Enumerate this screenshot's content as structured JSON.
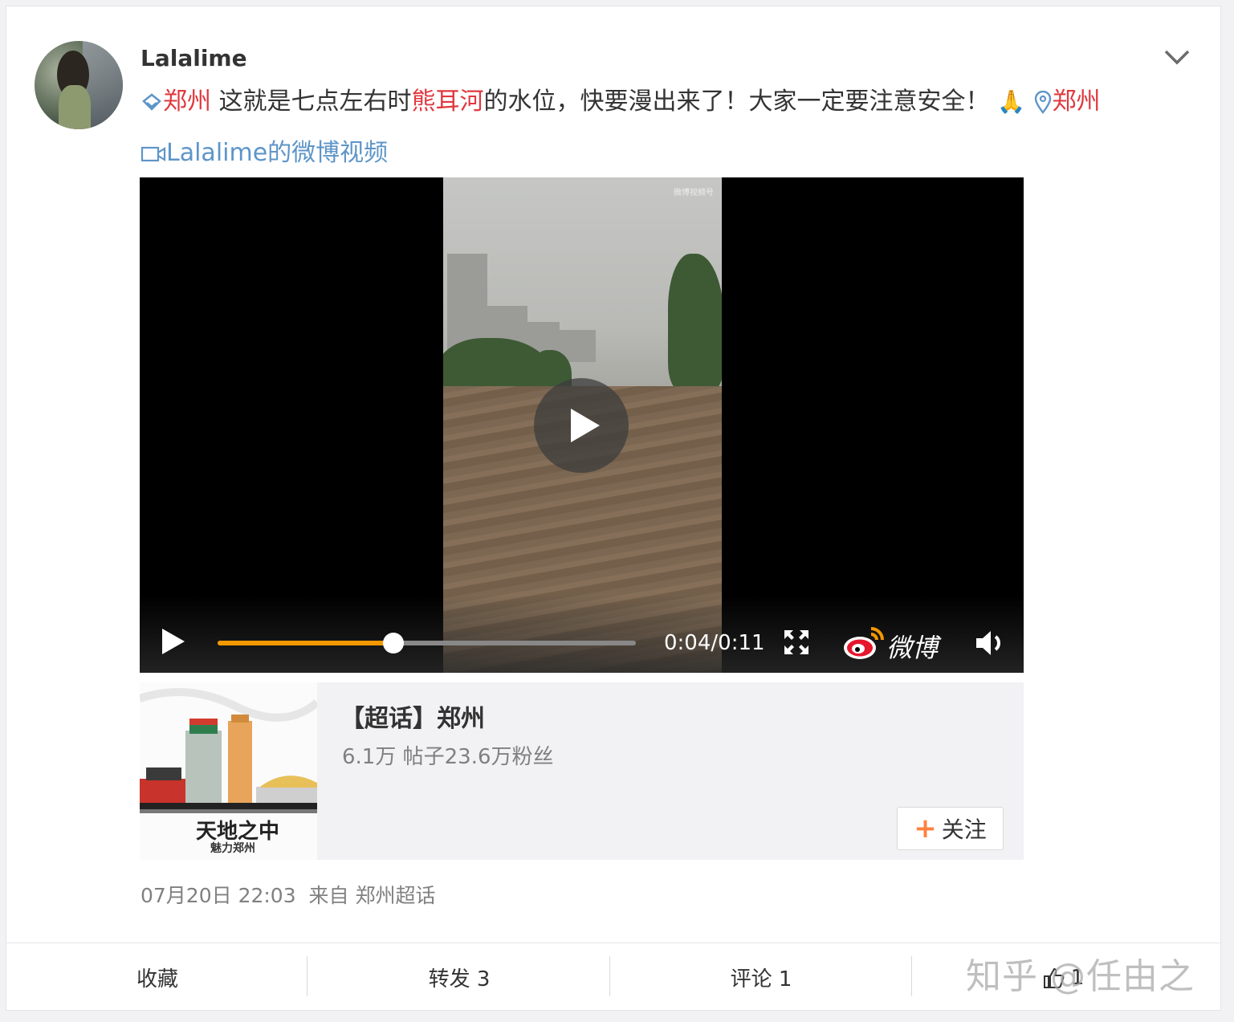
{
  "post": {
    "username": "Lalalime",
    "topic_tag": "郑州",
    "text_part1": " 这就是七点左右时",
    "highlight": "熊耳河",
    "text_part2": "的水位，快要漫出来了！大家一定要注意安全！",
    "emoji": "🙏",
    "location": "郑州",
    "video_link": "Lalalime的微博视频"
  },
  "video": {
    "watermark": "微博视频号",
    "time": "0:04/0:11",
    "progress": 0.42,
    "logo_text": "微博"
  },
  "topic_card": {
    "title": "【超话】郑州",
    "stats": "6.1万 帖子23.6万粉丝",
    "image_caption_line1": "天地之中",
    "image_caption_line2": "魅力郑州",
    "follow_label": "关注"
  },
  "meta": {
    "date": "07月20日 22:03",
    "from_label": "来自",
    "source": "郑州超话"
  },
  "actions": {
    "collect": "收藏",
    "repost": "转发 3",
    "comment": "评论 1",
    "like": "1"
  },
  "watermark": "知乎 @任由之",
  "colors": {
    "link_blue": "#5e95c8",
    "topic_orange": "#eb7350",
    "highlight_red": "#e0383e",
    "progress_orange": "#f39800"
  }
}
